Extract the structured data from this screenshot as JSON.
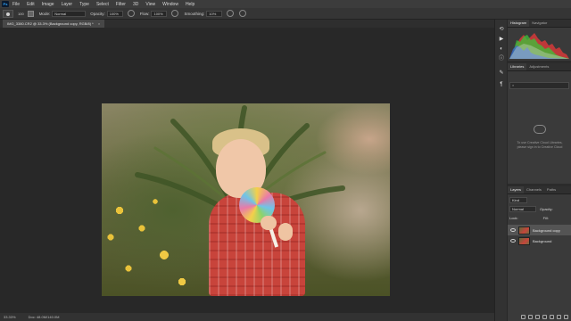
{
  "app": {
    "logo": "Ps"
  },
  "menu": [
    "File",
    "Edit",
    "Image",
    "Layer",
    "Type",
    "Select",
    "Filter",
    "3D",
    "View",
    "Window",
    "Help"
  ],
  "options": {
    "brush_size": "100",
    "mode_label": "Mode:",
    "mode_value": "Normal",
    "opacity_label": "Opacity:",
    "opacity_value": "100%",
    "flow_label": "Flow:",
    "flow_value": "100%",
    "smoothing_label": "Smoothing:",
    "smoothing_value": "10%"
  },
  "document": {
    "tab_title": "IMG_3380.CR2 @ 33.3% (Background copy, RGB/8) *",
    "close": "×"
  },
  "status": {
    "zoom": "33.33%",
    "doc": "Doc: 48.0M/140.0M"
  },
  "panels": {
    "top_tabs": [
      "Histogram",
      "Navigator"
    ],
    "mid_tabs": [
      "Libraries",
      "Adjustments"
    ],
    "search_placeholder": "",
    "library_message": "To use Creative Cloud Libraries, please sign in to Creative Cloud",
    "layer_tabs": [
      "Layers",
      "Channels",
      "Paths"
    ],
    "kind_label": "Kind",
    "blend_mode": "Normal",
    "opacity_label": "Opacity:",
    "lock_label": "Lock:",
    "fill_label": "Fill:",
    "layers": [
      {
        "name": "Background copy",
        "selected": true
      },
      {
        "name": "Background",
        "selected": false
      }
    ]
  },
  "colors": {
    "accent": "#31a8ff",
    "panel_bg": "#3a3a3a",
    "canvas_bg": "#282828"
  }
}
